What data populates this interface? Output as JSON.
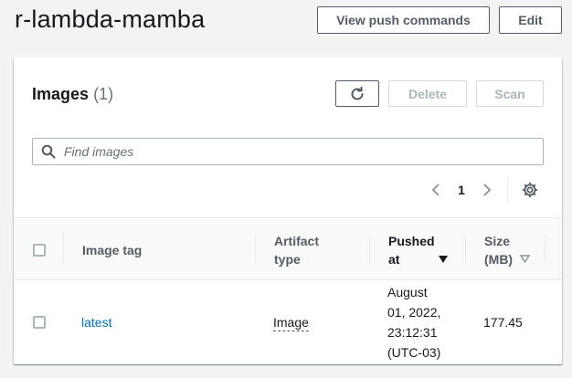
{
  "header": {
    "title": "r-lambda-mamba",
    "view_push_label": "View push commands",
    "edit_label": "Edit"
  },
  "panel": {
    "title": "Images",
    "count": "(1)",
    "delete_label": "Delete",
    "scan_label": "Scan",
    "search_placeholder": "Find images",
    "page_number": "1"
  },
  "table": {
    "columns": {
      "image_tag": "Image tag",
      "artifact_line1": "Artifact",
      "artifact_line2": "type",
      "pushed_line1": "Pushed",
      "pushed_line2": "at",
      "size_line1": "Size",
      "size_line2": "(MB)"
    },
    "rows": [
      {
        "tag": "latest",
        "artifact_type": "Image",
        "pushed_l1": "August",
        "pushed_l2": "01, 2022,",
        "pushed_l3": "23:12:31",
        "pushed_l4": "(UTC-03)",
        "size": "177.45"
      }
    ]
  },
  "colors": {
    "link": "#0073bb",
    "background": "#f2f3f3",
    "panel": "#ffffff"
  },
  "icons": [
    "refresh-icon",
    "search-icon",
    "chevron-left-icon",
    "chevron-right-icon",
    "settings-gear-icon",
    "sort-descending-icon",
    "sort-inactive-icon"
  ]
}
